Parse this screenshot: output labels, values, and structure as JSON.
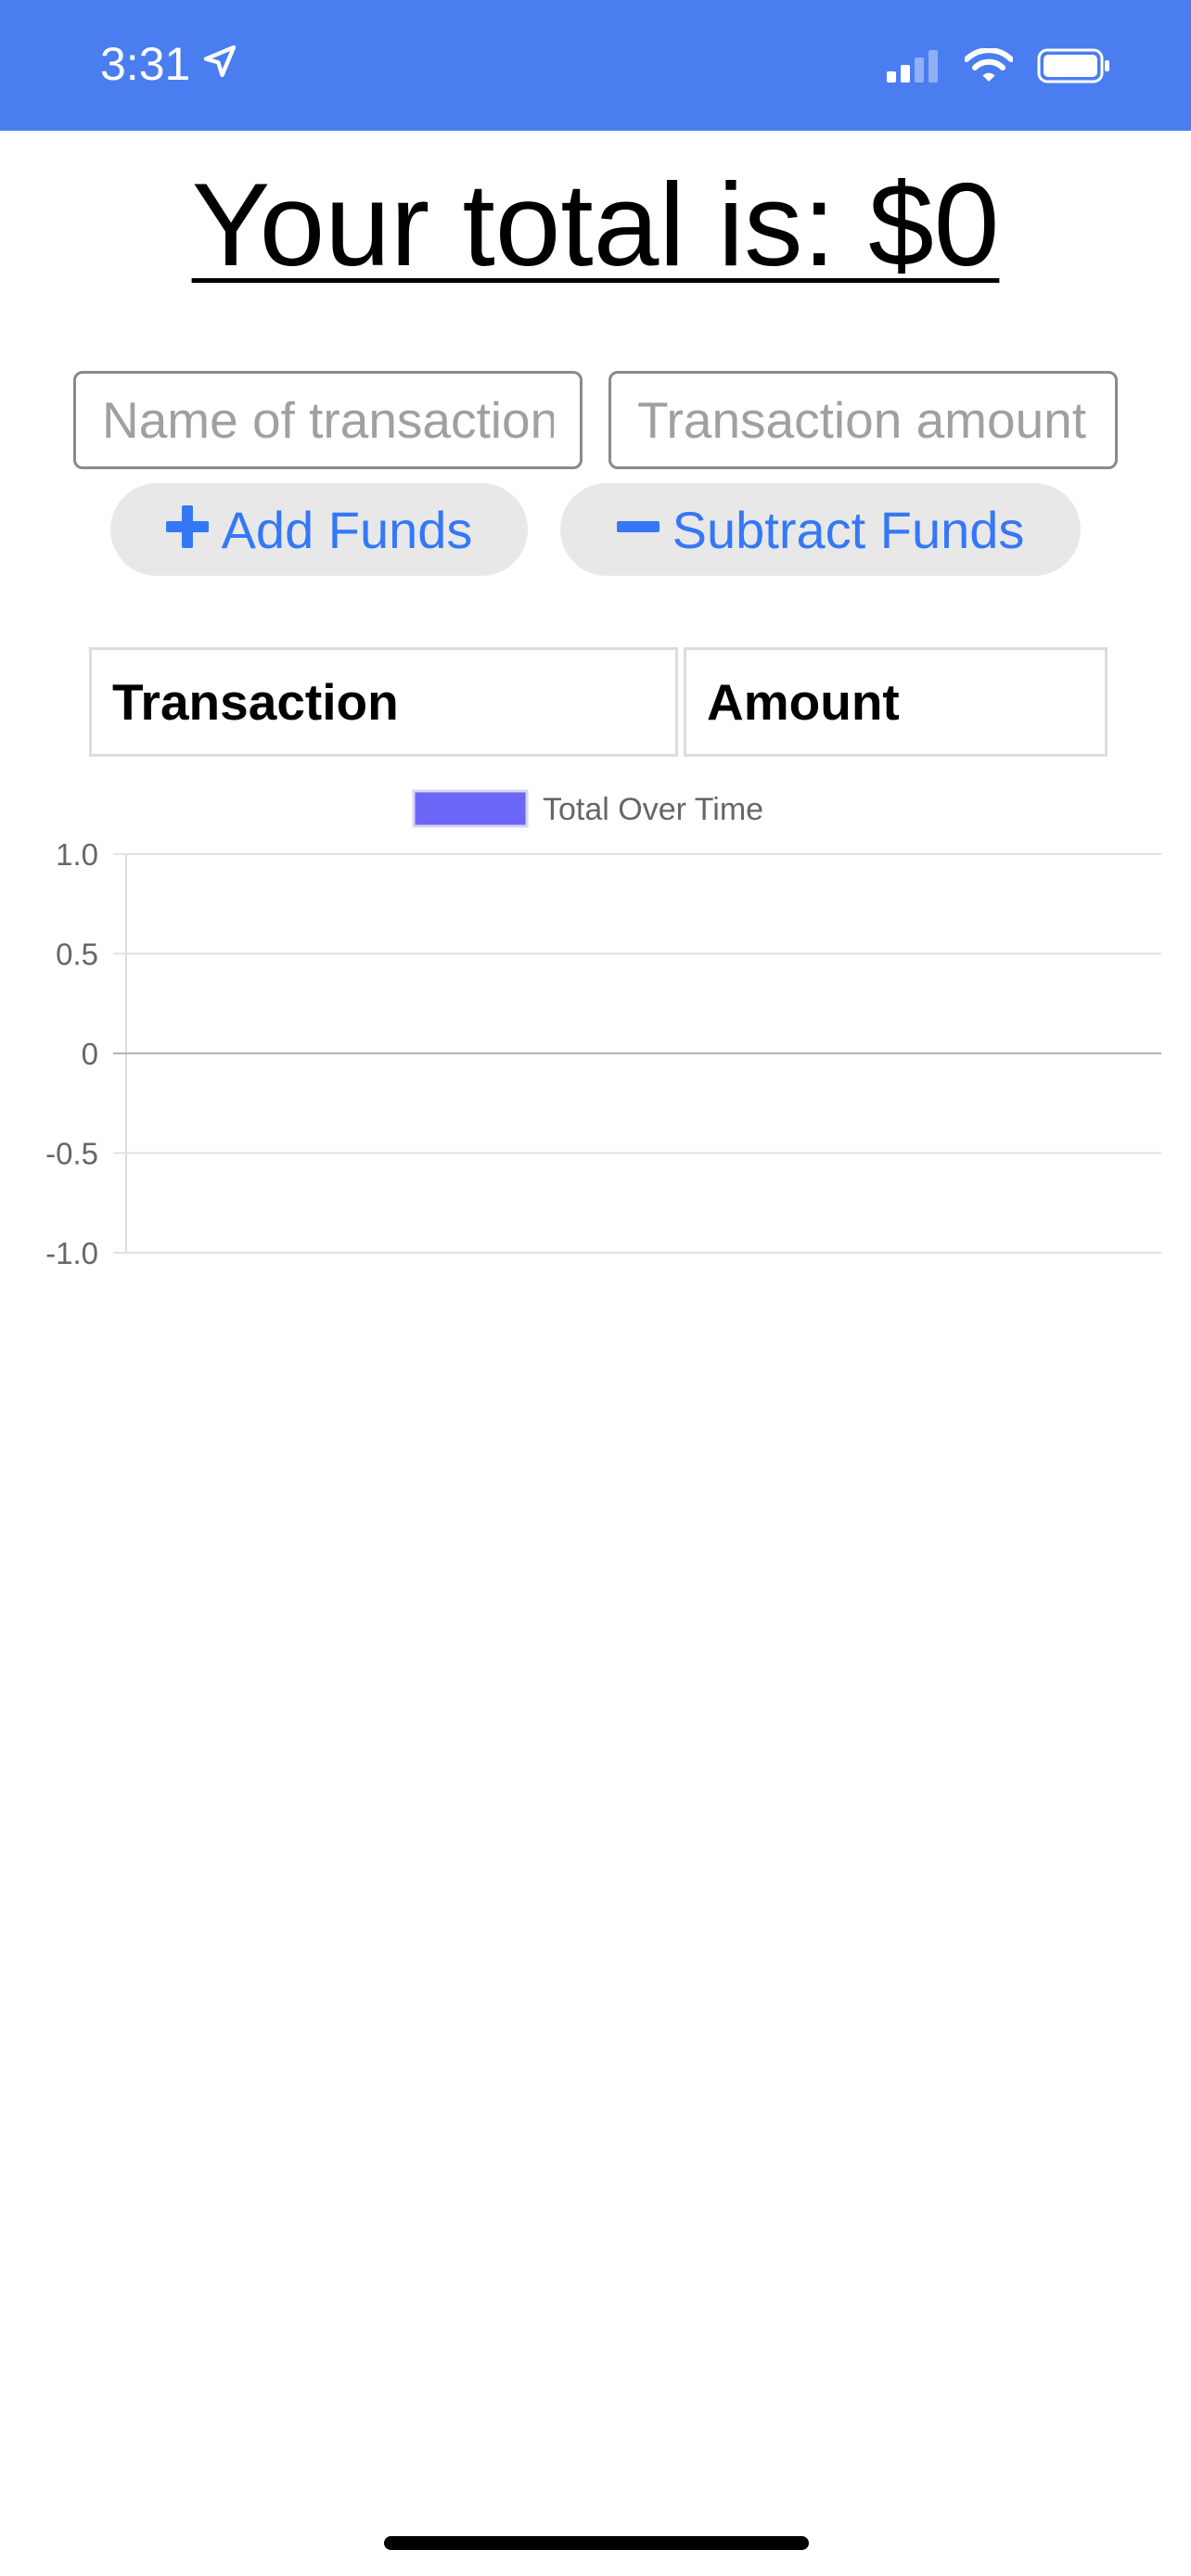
{
  "status_bar": {
    "time": "3:31",
    "color": "#4a7ef0",
    "icons": [
      "location-arrow-icon",
      "signal-icon",
      "wifi-icon",
      "battery-icon"
    ]
  },
  "header": {
    "title": "Your total is: $0"
  },
  "form": {
    "name_placeholder": "Name of transaction",
    "amount_placeholder": "Transaction amount",
    "name_value": "",
    "amount_value": "",
    "add_label": "Add Funds",
    "subtract_label": "Subtract Funds",
    "button_text_color": "#3478f6"
  },
  "table": {
    "headers": [
      "Transaction",
      "Amount"
    ],
    "rows": []
  },
  "chart_data": {
    "type": "line",
    "legend": "top",
    "series": [
      {
        "name": "Total Over Time",
        "color": "#6b66f5",
        "values": []
      }
    ],
    "x": [],
    "ylim": [
      -1.0,
      1.0
    ],
    "yticks": [
      "1.0",
      "0.5",
      "0",
      "-0.5",
      "-1.0"
    ],
    "grid": true
  }
}
